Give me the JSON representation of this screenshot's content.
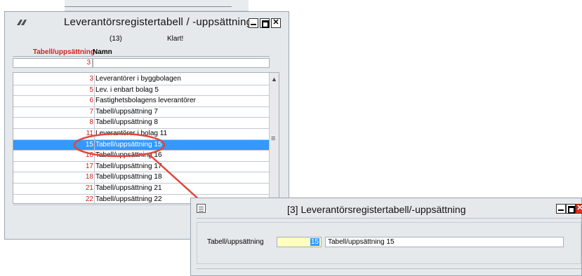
{
  "main_window": {
    "title": "Leverantörsregistertabell / -uppsättning",
    "count": "(13)",
    "status": "Klart!",
    "columns": {
      "code": "Tabell/uppsättning",
      "name": "Namn"
    },
    "filter": {
      "code": "3",
      "name": ""
    },
    "rows": [
      {
        "code": "3",
        "name": "Leverantörer i byggbolagen"
      },
      {
        "code": "5",
        "name": "Lev. i enbart bolag 5"
      },
      {
        "code": "6",
        "name": "Fastighetsbolagens leverantörer"
      },
      {
        "code": "7",
        "name": "Tabell/uppsättning 7"
      },
      {
        "code": "8",
        "name": "Tabell/uppsättning 8"
      },
      {
        "code": "11",
        "name": "Leverantörer i bolag 11"
      },
      {
        "code": "15",
        "name": "Tabell/uppsättning 15"
      },
      {
        "code": "16",
        "name": "Tabell/uppsättning 16"
      },
      {
        "code": "17",
        "name": "Tabell/uppsättning 17"
      },
      {
        "code": "18",
        "name": "Tabell/uppsättning 18"
      },
      {
        "code": "21",
        "name": "Tabell/uppsättning 21"
      },
      {
        "code": "22",
        "name": "Tabell/uppsättning 22"
      }
    ],
    "selected_row_code": "15",
    "scroll_up_icon": "▲",
    "scroll_thumb_icon": "≡"
  },
  "detail_window": {
    "title": "[3]  Leverantörsregistertabell/-uppsättning",
    "field_label": "Tabell/uppsättning",
    "code_value": "15",
    "name_value": "Tabell/uppsättning 15"
  },
  "colors": {
    "selection": "#3399ff",
    "code_text": "#d42020",
    "highlight": "#e0463c",
    "code_field_bg": "#ffffc0"
  }
}
